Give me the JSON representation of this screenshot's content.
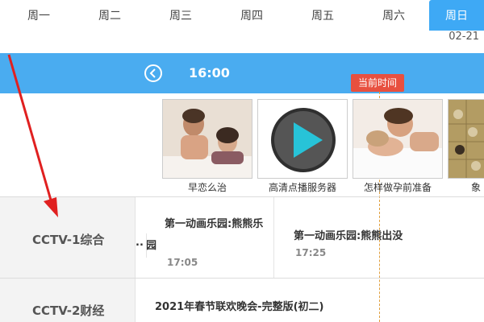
{
  "days": {
    "tabs": [
      {
        "label": "周一"
      },
      {
        "label": "周二"
      },
      {
        "label": "周三"
      },
      {
        "label": "周四"
      },
      {
        "label": "周五"
      },
      {
        "label": "周六"
      },
      {
        "label": "周日",
        "active": true
      }
    ],
    "active_date": "02-21"
  },
  "timebar": {
    "time": "16:00",
    "prev_icon": "chevron-left-icon"
  },
  "now_indicator": {
    "label": "当前时间"
  },
  "recommendations": [
    {
      "label": "早恋么治"
    },
    {
      "label": "高清点播服务器"
    },
    {
      "label": "怎样做孕前准备"
    },
    {
      "label": "象"
    }
  ],
  "channels": [
    {
      "name": "CCTV-1综合",
      "programs": [
        {
          "title_line1": "第一动画乐园:熊熊乐",
          "title_prefix": "..",
          "title_line2": "园",
          "time": "17:05"
        },
        {
          "title_line1": "第一动画乐园:熊熊出没",
          "time": "17:25"
        }
      ]
    },
    {
      "name": "CCTV-2财经",
      "programs": [
        {
          "title_line1": "2021年春节联欢晚会-完整版(初二)"
        }
      ]
    }
  ],
  "colors": {
    "accent": "#4aacf0",
    "now_badge": "#e8503f",
    "annotation_arrow": "#e02020"
  }
}
